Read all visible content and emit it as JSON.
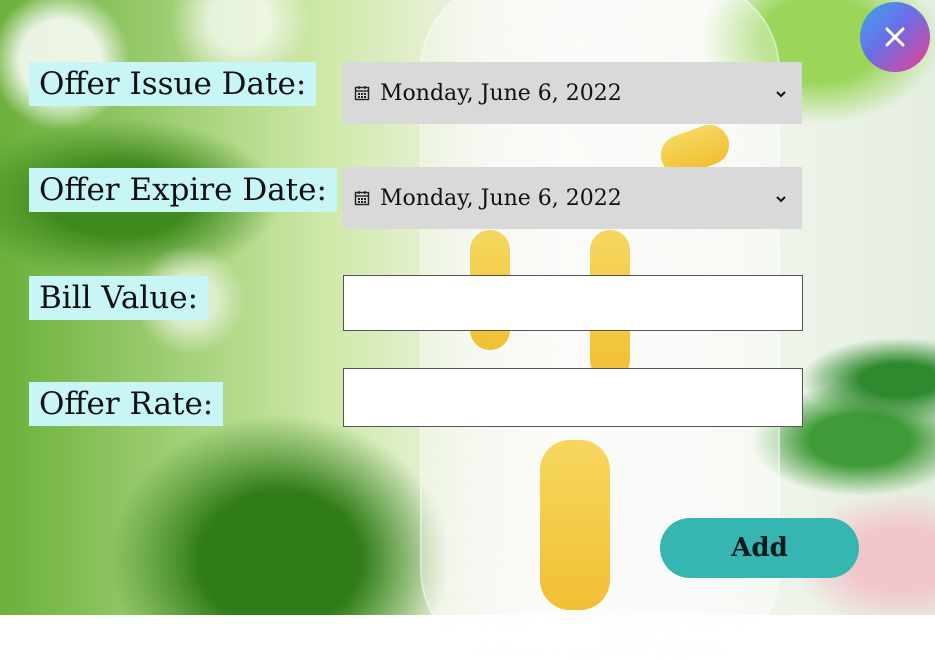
{
  "form": {
    "issue_date": {
      "label": "Offer Issue Date:",
      "value": "Monday, June 6, 2022"
    },
    "expire_date": {
      "label": "Offer Expire Date:",
      "value": "Monday, June 6, 2022"
    },
    "bill_value": {
      "label": "Bill Value:",
      "value": ""
    },
    "offer_rate": {
      "label": "Offer Rate:",
      "value": ""
    }
  },
  "actions": {
    "add_label": "Add"
  },
  "icons": {
    "calendar": "calendar-icon",
    "chevron": "chevron-down-icon",
    "close": "close-icon"
  },
  "colors": {
    "label_bg": "#c8f5f6",
    "date_field_bg": "#d9d9d9",
    "add_button": "#35b6b1",
    "close_gradient_start": "#3aa7e8",
    "close_gradient_end": "#ec3f8b"
  }
}
